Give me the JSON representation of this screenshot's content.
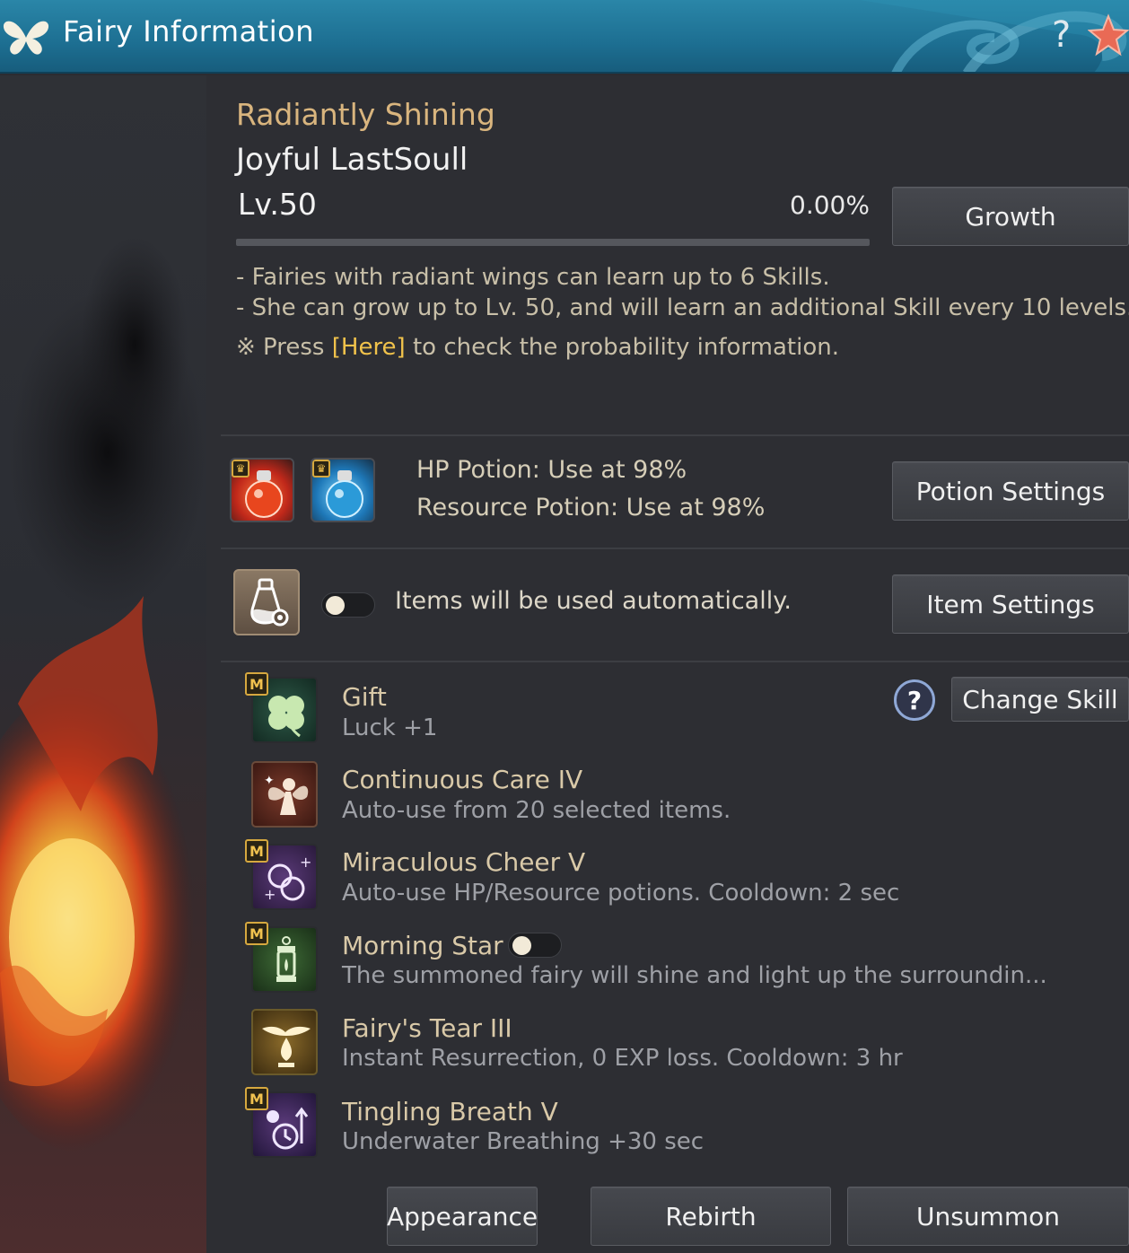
{
  "window": {
    "title": "Fairy Information",
    "help_glyph": "?"
  },
  "fairy": {
    "grade": "Radiantly Shining",
    "name": "Joyful LastSoull",
    "level": "Lv.50",
    "exp_percent": "0.00%",
    "exp_fraction": 0.0
  },
  "buttons": {
    "growth": "Growth",
    "potion_settings": "Potion Settings",
    "item_settings": "Item Settings",
    "change_skill": "Change Skill",
    "appearance": "Appearance",
    "rebirth": "Rebirth",
    "unsummon": "Unsummon"
  },
  "description": {
    "line1": "- Fairies with radiant wings can learn up to 6 Skills.",
    "line2": "- She can grow up to Lv. 50, and will learn an additional Skill every 10 levels.",
    "line3_prefix": "※ Press ",
    "line3_link": "[Here]",
    "line3_suffix": " to check the probability information."
  },
  "potions": {
    "hp": "HP Potion: Use at 98%",
    "resource": "Resource Potion: Use at 98%",
    "hp_icon": "red-potion-icon",
    "resource_icon": "blue-potion-icon"
  },
  "items": {
    "auto_text": "Items will be used automatically.",
    "auto_enabled": false
  },
  "skill_help_glyph": "?",
  "skills": [
    {
      "name": "Gift",
      "desc": "Luck +1",
      "badge": "M",
      "icon": "clover-icon"
    },
    {
      "name": "Continuous Care IV",
      "desc": "Auto-use from 20 selected items.",
      "badge": "",
      "icon": "fairy-icon"
    },
    {
      "name": "Miraculous Cheer V",
      "desc": "Auto-use HP/Resource potions. Cooldown: 2 sec",
      "badge": "M",
      "icon": "potions-icon"
    },
    {
      "name": "Morning Star",
      "desc": "The summoned fairy will shine and light up the surroundin...",
      "badge": "M",
      "icon": "lantern-icon",
      "toggle": false
    },
    {
      "name": "Fairy's Tear III",
      "desc": "Instant Resurrection, 0 EXP loss. Cooldown: 3 hr",
      "badge": "",
      "icon": "winged-tear-icon"
    },
    {
      "name": "Tingling Breath V",
      "desc": "Underwater Breathing +30 sec",
      "badge": "M",
      "icon": "breath-timer-icon"
    }
  ],
  "colors": {
    "titlebar": "#1d6f92",
    "grade_gold": "#d9b57e",
    "link_yellow": "#f0c24b",
    "badge_gold": "#d6a83f"
  }
}
